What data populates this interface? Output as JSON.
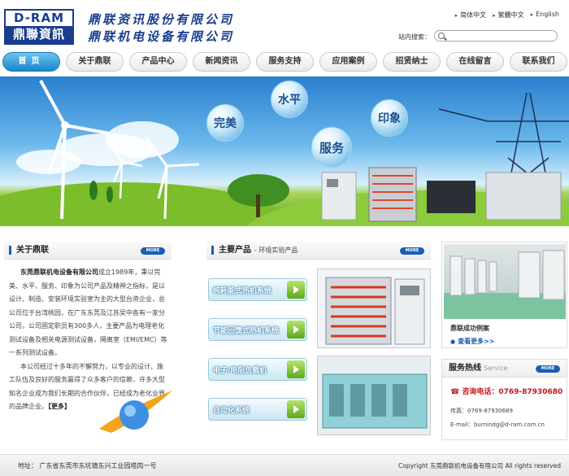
{
  "logo": {
    "top": "D-RAM",
    "bottom": "鼎聯資訊"
  },
  "company": {
    "line1": "鼎联资讯股份有限公司",
    "line2": "鼎联机电设备有限公司"
  },
  "lang": {
    "simplified": "简体中文",
    "traditional": "繁體中文",
    "english": "English"
  },
  "search": {
    "label": "站内搜索：",
    "value": ""
  },
  "nav": [
    {
      "label": "首页"
    },
    {
      "label": "关于鼎联"
    },
    {
      "label": "产品中心"
    },
    {
      "label": "新闻资讯"
    },
    {
      "label": "服务支持"
    },
    {
      "label": "应用案例"
    },
    {
      "label": "招贤纳士"
    },
    {
      "label": "在线留言"
    },
    {
      "label": "联系我们"
    }
  ],
  "banner": {
    "bubbles": [
      "完美",
      "水平",
      "服务",
      "印象"
    ]
  },
  "about": {
    "title": "关于鼎联",
    "more_badge": "MORE",
    "company_name": "东莞鼎联机电设备有限公司",
    "p1": "成立1989年，秉以完美、水平、服务、印象为公司产品及精神之指标，是以设计、制造、安装环境实验室为主的大型台资企业，总公司位于台湾桃园，在广东东莞及江苏吴中各有一家分公司，公司固定职员有300多人，主要产品为电理老化测试设备及相关电源测试设备，隔离室（EMI/EMC）等一系列测试设备。",
    "p2": "本公司经过十多年的不懈努力，以专业的设计、施工队伍及良好的服务赢得了众多客户的信赖，许多大型知名企业成为我们长期的合作伙伴，已经成为老化业界的品牌企业。",
    "more_link": "【更多】"
  },
  "products": {
    "title": "主要产品",
    "subtitle": "- 环境实验产品",
    "more_badge": "MORE",
    "items": [
      {
        "label": "纯耗能式热机系统"
      },
      {
        "label": "节能回馈式热机系统"
      },
      {
        "label": "电子/电阻负载机"
      },
      {
        "label": "自动化系统"
      }
    ]
  },
  "cases": {
    "title": "鼎联成功例案",
    "more": "查看更多>>"
  },
  "hotline": {
    "title": "服务热线",
    "title_en": "Service",
    "more_badge": "MORE",
    "phone_label": "咨询电话：",
    "phone": "0769-87930680",
    "fax": "传真：0769-87930689",
    "email": "E-mail：burnindg@d-ram.com.cn"
  },
  "footer": {
    "address": "地址：  广东省东莞市东坑镇东兴工业园塔岗一号",
    "copyright": "Copyright 东莞鼎联机电设备有限公司 All rights reserved"
  },
  "colors": {
    "brand": "#1a3d8f",
    "nav_active": "#1787cc",
    "accent_green": "#5da81c",
    "phone_red": "#c4141a"
  }
}
